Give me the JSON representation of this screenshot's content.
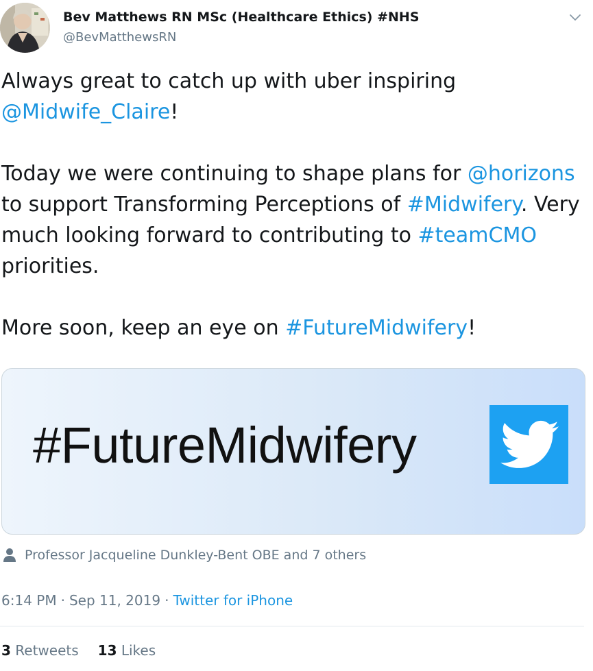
{
  "author": {
    "name": "Bev Matthews RN MSc (Healthcare Ethics) #NHS",
    "handle": "@BevMatthewsRN"
  },
  "tweet": {
    "p1": {
      "t1": "Always great to catch up with uber inspiring ",
      "mention": "@Midwife_Claire",
      "t2": "!"
    },
    "p2": {
      "t1": "Today we were continuing to shape plans for ",
      "mention": "@horizons",
      "t2": " to support Transforming Perceptions of ",
      "hashtag1": "#Midwifery",
      "t3": ". Very much looking forward to contributing to ",
      "hashtag2": "#teamCMO",
      "t4": " priorities."
    },
    "p3": {
      "t1": "More soon, keep an eye on ",
      "hashtag": "#FutureMidwifery",
      "t2": "!"
    }
  },
  "media": {
    "text": "#FutureMidwifery",
    "logo_color": "#1da1f2"
  },
  "tagged": {
    "icon": "person-icon",
    "text": "Professor Jacqueline Dunkley-Bent OBE and 7 others"
  },
  "meta": {
    "time": "6:14 PM",
    "date": "Sep 11, 2019",
    "separator": "·",
    "source": "Twitter for iPhone"
  },
  "stats": {
    "retweets_count": "3",
    "retweets_label": "Retweets",
    "likes_count": "13",
    "likes_label": "Likes"
  },
  "colors": {
    "link": "#1b95e0",
    "secondary_text": "#657786",
    "primary_text": "#14171a"
  }
}
